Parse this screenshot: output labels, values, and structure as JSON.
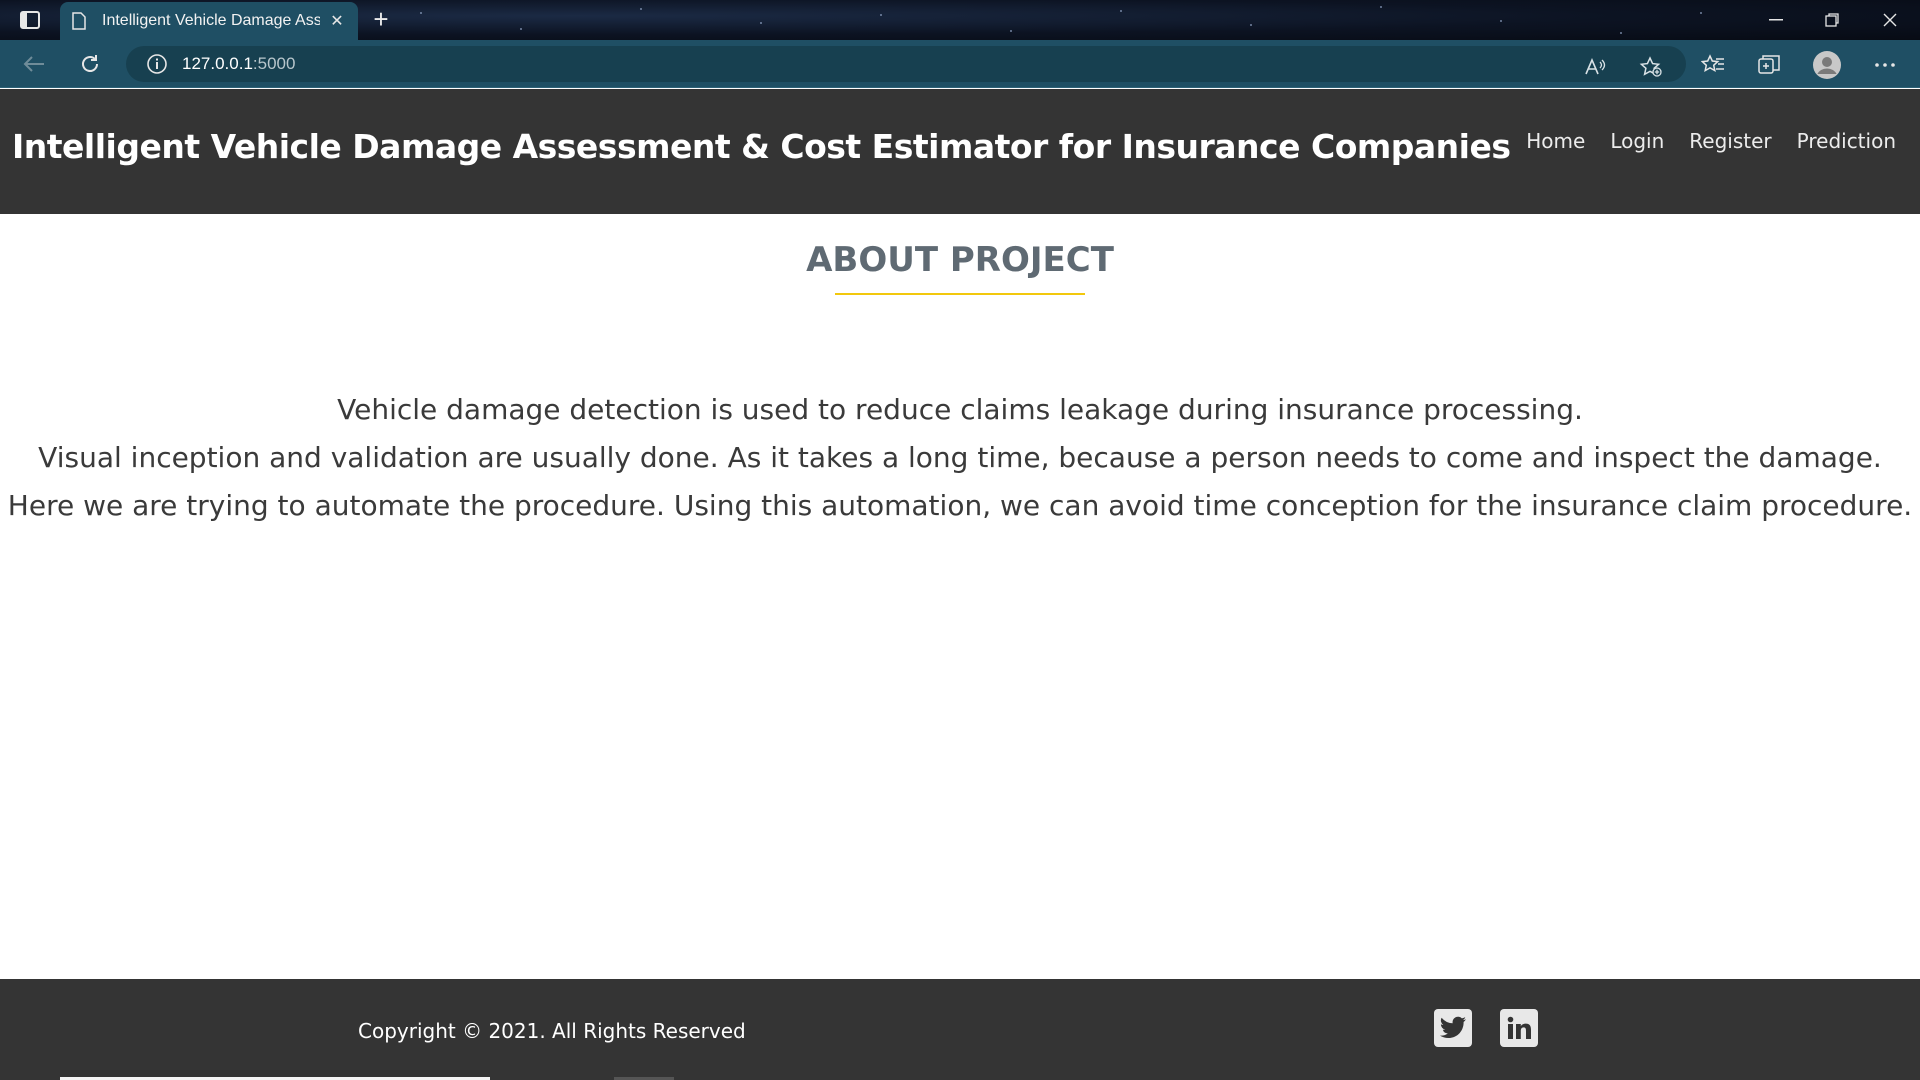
{
  "browser": {
    "tab_title": "Intelligent Vehicle Damage Asse",
    "tab_close": "✕",
    "new_tab": "+",
    "url_host": "127.0.0.1",
    "url_port": ":5000"
  },
  "header": {
    "title": "Intelligent Vehicle Damage Assessment & Cost Estimator for Insurance Companies",
    "nav": [
      "Home",
      "Login",
      "Register",
      "Prediction"
    ]
  },
  "about": {
    "heading": "ABOUT PROJECT",
    "lines": [
      "Vehicle damage detection is used to reduce claims leakage during insurance processing.",
      "Visual inception and validation are usually done. As it takes a long time, because a person needs to come and inspect the damage.",
      "Here we are trying to automate the procedure. Using this automation, we can avoid time conception for the insurance claim procedure."
    ]
  },
  "footer": {
    "copyright": "Copyright © 2021. All Rights Reserved",
    "social": [
      "twitter-icon",
      "linkedin-icon"
    ]
  },
  "colors": {
    "header_bg": "#343434",
    "accent_underline": "#f2c80d",
    "heading_text": "#5f6a73",
    "browser_chrome": "#1f4f64"
  }
}
